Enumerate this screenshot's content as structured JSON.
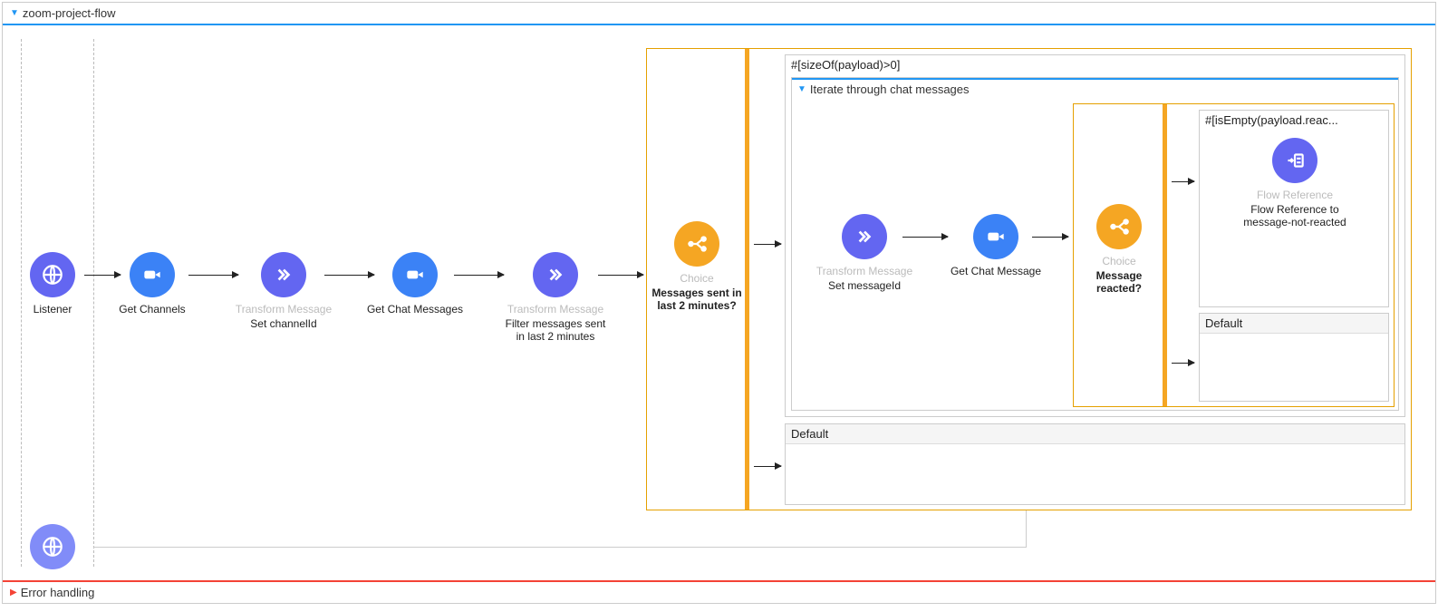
{
  "flowName": "zoom-project-flow",
  "errorSection": "Error handling",
  "nodes": {
    "listener": {
      "name": "Listener"
    },
    "getChannels": {
      "name": "Get Channels"
    },
    "setChannelId": {
      "type": "Transform Message",
      "name": "Set channelId"
    },
    "getChatMessages": {
      "name": "Get Chat Messages"
    },
    "filter": {
      "type": "Transform Message",
      "name": "Filter messages sent in last 2 minutes"
    },
    "choice1": {
      "type": "Choice",
      "name": "Messages sent in last 2 minutes?"
    },
    "choice1when": "#[sizeOf(payload)>0]",
    "choice1default": "Default",
    "iterate": {
      "title": "Iterate through chat messages"
    },
    "setMessageId": {
      "type": "Transform Message",
      "name": "Set messageId"
    },
    "getChatMessage": {
      "name": "Get Chat Message"
    },
    "choice2": {
      "type": "Choice",
      "name": "Message reacted?"
    },
    "choice2when": "#[isEmpty(payload.reac...",
    "choice2default": "Default",
    "flowRef": {
      "type": "Flow Reference",
      "name": "Flow Reference to message-not-reacted"
    }
  }
}
